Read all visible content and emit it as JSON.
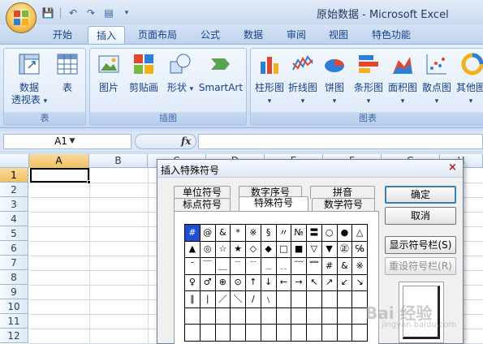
{
  "window": {
    "title": "原始数据 - Microsoft Excel"
  },
  "qat": {
    "icons": [
      "save-icon",
      "undo-icon",
      "redo-icon",
      "form-icon",
      "customize-icon"
    ],
    "glyphs": [
      "💾",
      "↶",
      "↷",
      "▤",
      "▾"
    ]
  },
  "ribbon_tabs": [
    "开始",
    "插入",
    "页面布局",
    "公式",
    "数据",
    "审阅",
    "视图",
    "特色功能"
  ],
  "active_tab": "插入",
  "groups": {
    "table": {
      "label": "表",
      "pivot_label_1": "数据",
      "pivot_label_2": "透视表",
      "pivot_caret": "▾",
      "table_label": "表"
    },
    "illustrations": {
      "label": "插图",
      "picture": "图片",
      "clipart": "剪贴画",
      "shapes": "形状",
      "shapes_caret": "▾",
      "smartart": "SmartArt"
    },
    "charts": {
      "label": "图表",
      "items": [
        "柱形图",
        "折线图",
        "饼图",
        "条形图",
        "面积图",
        "散点图",
        "其他图"
      ],
      "caret": "▾"
    }
  },
  "formula_bar": {
    "name_box": "A1",
    "fx": "fx",
    "formula": ""
  },
  "columns": [
    "A",
    "B",
    "C",
    "D",
    "E",
    "F",
    "G",
    "H"
  ],
  "rows": [
    "1",
    "2",
    "3",
    "4",
    "5",
    "6",
    "7",
    "8",
    "9",
    "10",
    "11",
    "12"
  ],
  "dialog": {
    "title": "插入特殊符号",
    "close": "×",
    "tabs_back": [
      "单位符号",
      "数字序号",
      "拼音"
    ],
    "tabs_front": [
      "标点符号",
      "特殊符号",
      "数学符号"
    ],
    "active_tab": "特殊符号",
    "symbols": [
      [
        "#",
        "@",
        "&",
        "*",
        "※",
        "§",
        "〃",
        "№",
        "〓",
        "○",
        "●",
        "△"
      ],
      [
        "▲",
        "◎",
        "☆",
        "★",
        "◇",
        "◆",
        "□",
        "■",
        "▽",
        "▼",
        "㊣",
        "℅"
      ],
      [
        "ˉ",
        "￣",
        "＿",
        "﹉",
        "﹊",
        "﹍",
        "﹎",
        "﹋",
        "﹌",
        "#",
        "&",
        "※"
      ],
      [
        "♀",
        "♂",
        "⊕",
        "⊙",
        "↑",
        "↓",
        "←",
        "→",
        "↖",
        "↗",
        "↙",
        "↘"
      ],
      [
        "∥",
        "∣",
        "／",
        "＼",
        "∕",
        "﹨",
        "",
        "",
        "",
        "",
        "",
        ""
      ],
      [
        "",
        "",
        "",
        "",
        "",
        "",
        "",
        "",
        "",
        "",
        "",
        ""
      ],
      [
        "",
        "",
        "",
        "",
        "",
        "",
        "",
        "",
        "",
        "",
        "",
        ""
      ]
    ],
    "buttons": {
      "ok": "确定",
      "cancel": "取消",
      "show_bar": "显示符号栏(S)",
      "reset_bar": "重设符号栏(R)"
    }
  },
  "watermark": "Bai 经验",
  "watermark_sub": "jingyan.baidu.com",
  "colors": {
    "accent": "#15428b",
    "selected_symbol": "#1f4fd1",
    "header_highlight": "#f1c15f"
  }
}
